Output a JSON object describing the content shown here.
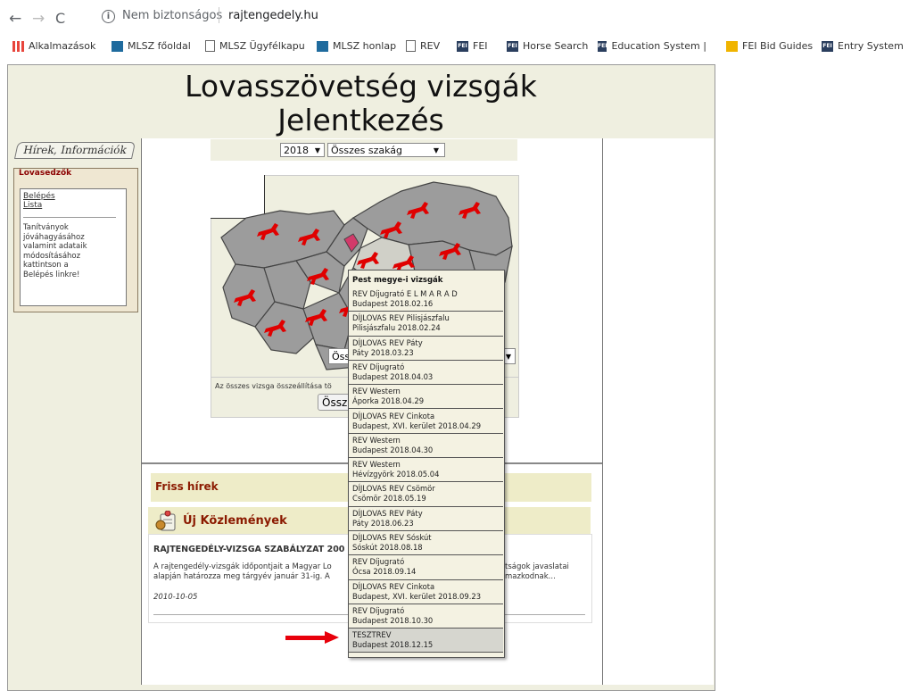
{
  "browser": {
    "security_text": "Nem biztonságos",
    "url": "rajtengedely.hu",
    "bookmarks": [
      {
        "label": "Alkalmazások",
        "icon": "apps-grid-icon"
      },
      {
        "label": "MLSZ főoldal",
        "icon": "mlsz-icon"
      },
      {
        "label": "MLSZ Ügyfélkapu",
        "icon": "page-icon"
      },
      {
        "label": "MLSZ honlap",
        "icon": "mlsz-icon"
      },
      {
        "label": "REV",
        "icon": "page-icon"
      },
      {
        "label": "FEI",
        "icon": "fei-icon"
      },
      {
        "label": "Horse Search",
        "icon": "fei-icon"
      },
      {
        "label": "Education System | FEI",
        "icon": "fei-icon"
      },
      {
        "label": "FEI Bid Guides",
        "icon": "fei-flag-icon"
      },
      {
        "label": "Entry System",
        "icon": "fei-icon"
      }
    ]
  },
  "header": {
    "line1": "Lovasszövetség vizsgák",
    "line2": "Jelentkezés"
  },
  "sidebar": {
    "tab_label": "Hírek, Információk",
    "box_title": "Lovasedzők",
    "links": [
      "Belépés",
      "Lista"
    ],
    "text_lines": [
      "Tanítványok",
      "jóváhagyásához",
      "valamint adataik",
      "módosításához",
      "kattintson a",
      "Belépés linkre!"
    ]
  },
  "filters": {
    "year": "2018",
    "branch": "Összes szakág"
  },
  "map": {
    "select_value": "Öss",
    "info_text": "Az összes vizsga összeállítása tö",
    "button_label": "Össz"
  },
  "news": {
    "friss_title": "Friss hírek",
    "uj_title": "Új Közlemények",
    "article_title": "RAJTENGEDÉLY-VIZSGA SZABÁLYZAT 200",
    "line1_left": "A rajtengedély-vizsgák időpontjait a Magyar Lo",
    "line1_right": "tságok javaslatai",
    "line2_left": "alapján határozza meg tárgyév január 31-ig. A",
    "line2_right": "mazkodnak...",
    "date": "2010-10-05"
  },
  "popup": {
    "title": "Pest megye-i vizsgák",
    "items": [
      {
        "name": "REV Díjugrató E L M A R A D",
        "place": "Budapest 2018.02.16"
      },
      {
        "name": "DÍJLOVAS REV Pilisjászfalu",
        "place": "Pilisjászfalu 2018.02.24"
      },
      {
        "name": "DÍJLOVAS REV Páty",
        "place": "Páty 2018.03.23"
      },
      {
        "name": "REV Díjugrató",
        "place": "Budapest 2018.04.03"
      },
      {
        "name": "REV Western",
        "place": "Áporka 2018.04.29"
      },
      {
        "name": "DÍJLOVAS REV Cinkota",
        "place": "Budapest, XVI. kerület 2018.04.29"
      },
      {
        "name": "REV Western",
        "place": "Budapest 2018.04.30"
      },
      {
        "name": "REV Western",
        "place": "Hévízgyörk 2018.05.04"
      },
      {
        "name": "DÍJLOVAS REV Csömör",
        "place": "Csömör 2018.05.19"
      },
      {
        "name": "DÍJLOVAS REV Páty",
        "place": "Páty 2018.06.23"
      },
      {
        "name": "DÍJLOVAS REV Sóskút",
        "place": "Sóskút 2018.08.18"
      },
      {
        "name": "REV Díjugrató",
        "place": "Ócsa 2018.09.14"
      },
      {
        "name": "DÍJLOVAS REV Cinkota",
        "place": "Budapest, XVI. kerület 2018.09.23"
      },
      {
        "name": "REV Díjugrató",
        "place": "Budapest 2018.10.30"
      },
      {
        "name": "TESZTREV",
        "place": "Budapest 2018.12.15"
      }
    ]
  },
  "colors": {
    "page_bg": "#efefe0",
    "news_bar": "#eeecc8",
    "title_red": "#8b1a00",
    "arrow": "#e8000b",
    "horse": "#e00000"
  }
}
